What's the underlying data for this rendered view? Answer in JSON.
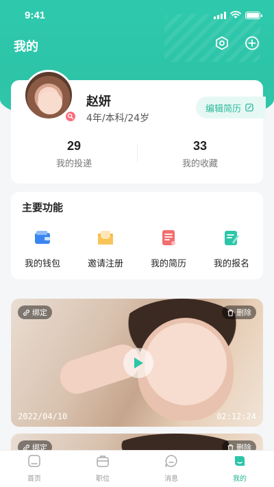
{
  "status_bar": {
    "time": "9:41"
  },
  "header": {
    "title": "我的"
  },
  "profile": {
    "name": "赵妍",
    "meta": "4年/本科/24岁",
    "edit_label": "编辑简历",
    "stats": [
      {
        "value": "29",
        "label": "我的投递"
      },
      {
        "value": "33",
        "label": "我的收藏"
      }
    ]
  },
  "functions": {
    "title": "主要功能",
    "items": [
      {
        "label": "我的钱包",
        "icon": "wallet-icon",
        "color": "#3a86f0"
      },
      {
        "label": "邀请注册",
        "icon": "envelope-icon",
        "color": "#f5b63a"
      },
      {
        "label": "我的简历",
        "icon": "resume-icon",
        "color": "#f26d6d"
      },
      {
        "label": "我的报名",
        "icon": "signup-icon",
        "color": "#2cc5a8"
      }
    ]
  },
  "videos": [
    {
      "bind_label": "绑定",
      "delete_label": "删除",
      "date": "2022/04/10",
      "duration": "02:12:24"
    },
    {
      "bind_label": "绑定",
      "delete_label": "删除"
    }
  ],
  "tab_bar": {
    "tabs": [
      {
        "label": "首页",
        "icon": "home-icon"
      },
      {
        "label": "职位",
        "icon": "briefcase-icon"
      },
      {
        "label": "消息",
        "icon": "message-icon"
      },
      {
        "label": "我的",
        "icon": "me-icon",
        "active": true
      }
    ]
  },
  "colors": {
    "brand": "#2ec9ad",
    "active_tab": "#26b394"
  }
}
